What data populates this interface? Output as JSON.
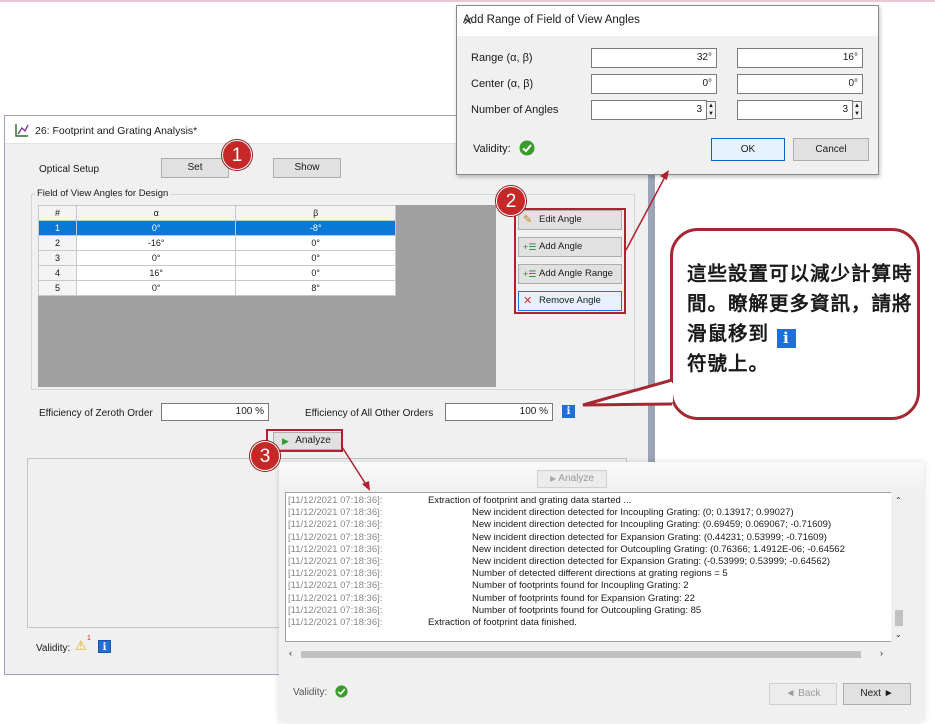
{
  "main_window": {
    "title": "26: Footprint and Grating Analysis*",
    "optical_setup_label": "Optical Setup",
    "set_button": "Set",
    "show_button": "Show",
    "fov_group_label": "Field of View Angles for Design",
    "table": {
      "headers": [
        "#",
        "α",
        "β"
      ],
      "rows": [
        [
          "1",
          "0°",
          "-8°"
        ],
        [
          "2",
          "-16°",
          "0°"
        ],
        [
          "3",
          "0°",
          "0°"
        ],
        [
          "4",
          "16°",
          "0°"
        ],
        [
          "5",
          "0°",
          "8°"
        ]
      ],
      "selected_row": 1
    },
    "side_buttons": {
      "edit": "Edit Angle",
      "add": "Add Angle",
      "add_range": "Add Angle Range",
      "remove": "Remove Angle"
    },
    "efficiency_zeroth_label": "Efficiency of Zeroth Order",
    "efficiency_zeroth_value": "100 %",
    "efficiency_other_label": "Efficiency of All Other Orders",
    "efficiency_other_value": "100 %",
    "analyze_button": "Analyze",
    "validity_label": "Validity:",
    "warning_count": "1"
  },
  "dialog": {
    "title": "Add Range of Field of View Angles",
    "close_glyph": "✕",
    "range_label": "Range (α, β)",
    "range_a": "32°",
    "range_b": "16°",
    "center_label": "Center (α, β)",
    "center_a": "0°",
    "center_b": "0°",
    "num_label": "Number of Angles",
    "num_a": "3",
    "num_b": "3",
    "validity_label": "Validity:",
    "ok": "OK",
    "cancel": "Cancel"
  },
  "log_window": {
    "analyze_button": "Analyze",
    "lines": [
      {
        "ts": "[11/12/2021 07:18:36]:",
        "msg": "Extraction of footprint and grating data started ...",
        "indent": false
      },
      {
        "ts": "[11/12/2021 07:18:36]:",
        "msg": "New incident direction detected for Incoupling Grating: (0; 0.13917; 0.99027)",
        "indent": true
      },
      {
        "ts": "[11/12/2021 07:18:36]:",
        "msg": "New incident direction detected for Incoupling Grating: (0.69459; 0.069067; -0.71609)",
        "indent": true
      },
      {
        "ts": "[11/12/2021 07:18:36]:",
        "msg": "New incident direction detected for Expansion Grating: (0.44231; 0.53999; -0.71609)",
        "indent": true
      },
      {
        "ts": "[11/12/2021 07:18:36]:",
        "msg": "New incident direction detected for Outcoupling Grating: (0.76366; 1.4912E-06; -0.64562",
        "indent": true
      },
      {
        "ts": "[11/12/2021 07:18:36]:",
        "msg": "New incident direction detected for Expansion Grating: (-0.53999; 0.53999; -0.64562)",
        "indent": true
      },
      {
        "ts": "[11/12/2021 07:18:36]:",
        "msg": "Number of detected different directions at grating regions = 5",
        "indent": true
      },
      {
        "ts": "[11/12/2021 07:18:36]:",
        "msg": "Number of footprints found for Incoupling Grating: 2",
        "indent": true
      },
      {
        "ts": "[11/12/2021 07:18:36]:",
        "msg": "Number of footprints found for Expansion Grating: 22",
        "indent": true
      },
      {
        "ts": "[11/12/2021 07:18:36]:",
        "msg": "Number of footprints found for Outcoupling Grating: 85",
        "indent": true
      },
      {
        "ts": "[11/12/2021 07:18:36]:",
        "msg": "Extraction of footprint data finished.",
        "indent": false
      }
    ],
    "validity_label": "Validity:",
    "back_button": "◄ Back",
    "next_button": "Next ►"
  },
  "callout": {
    "text_before_icon": "這些設置可以減少計算時間。瞭解更多資訊，請將滑鼠移到",
    "icon_glyph": "i",
    "text_after_icon": "符號上。"
  },
  "badges": [
    "1",
    "2",
    "3"
  ],
  "colors": {
    "accent_red": "#b0212d",
    "selection_blue": "#0a78d7",
    "info_blue": "#1e6fd8",
    "check_green": "#3a9b2c"
  }
}
